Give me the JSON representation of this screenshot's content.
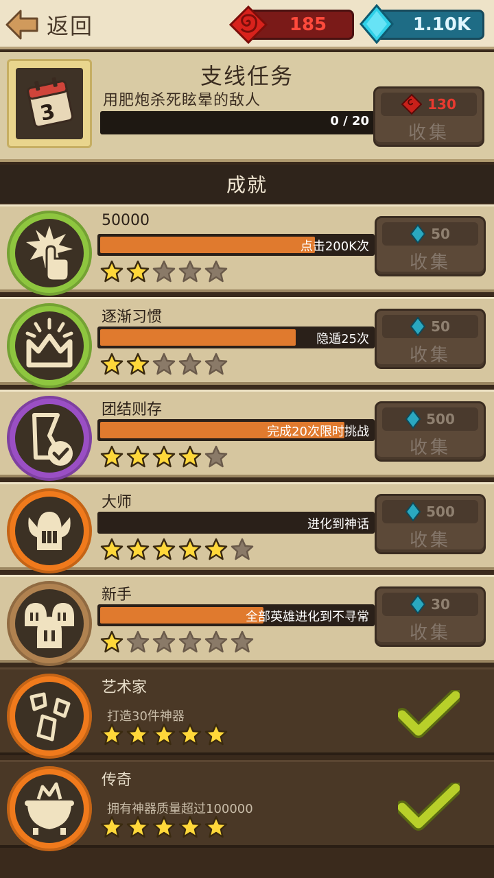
{
  "header": {
    "back_label": "返回",
    "ruby_count": "185",
    "gem_count": "1.10K"
  },
  "quest": {
    "title": "支线任务",
    "description": "用肥炮杀死眩晕的敌人",
    "progress_text": "0 / 20",
    "progress": 0,
    "calendar_day": "3",
    "reward": "130",
    "reward_type": "ruby",
    "collect_label": "收集"
  },
  "achievements_title": "成就",
  "achievements": [
    {
      "title": "50000",
      "bar_text": "点击200K次",
      "progress": 0.79,
      "stars": 2,
      "reward": "50",
      "collect_label": "收集",
      "badge_color": "#8ec63f",
      "badge_icon": "tap-burst-icon",
      "state": "active"
    },
    {
      "title": "逐渐习惯",
      "bar_text": "隐遁25次",
      "progress": 0.72,
      "stars": 2,
      "reward": "50",
      "collect_label": "收集",
      "badge_color": "#8ec63f",
      "badge_icon": "crown-burst-icon",
      "state": "active"
    },
    {
      "title": "团结则存",
      "bar_text": "完成20次限时挑战",
      "progress": 0.9,
      "stars": 4,
      "reward": "500",
      "collect_label": "收集",
      "badge_color": "#9a4fc4",
      "badge_icon": "hourglass-check-icon",
      "state": "active"
    },
    {
      "title": "大师",
      "bar_text": "进化到神话",
      "progress": 0,
      "stars": 5,
      "reward": "500",
      "collect_label": "收集",
      "badge_color": "#f07a1c",
      "badge_icon": "horned-helmet-icon",
      "state": "active"
    },
    {
      "title": "新手",
      "bar_text": "全部英雄进化到不寻常",
      "progress": 0.6,
      "stars": 1,
      "reward": "30",
      "collect_label": "收集",
      "badge_color": "#b08250",
      "badge_icon": "three-helmets-icon",
      "state": "active"
    },
    {
      "title": "艺术家",
      "description": "打造30件神器",
      "stars": 5,
      "badge_color": "#f07a1c",
      "badge_icon": "artifacts-icon",
      "state": "done"
    },
    {
      "title": "传奇",
      "description": "拥有神器质量超过100000",
      "stars": 5,
      "badge_color": "#f07a1c",
      "badge_icon": "cauldron-icon",
      "state": "done"
    }
  ]
}
